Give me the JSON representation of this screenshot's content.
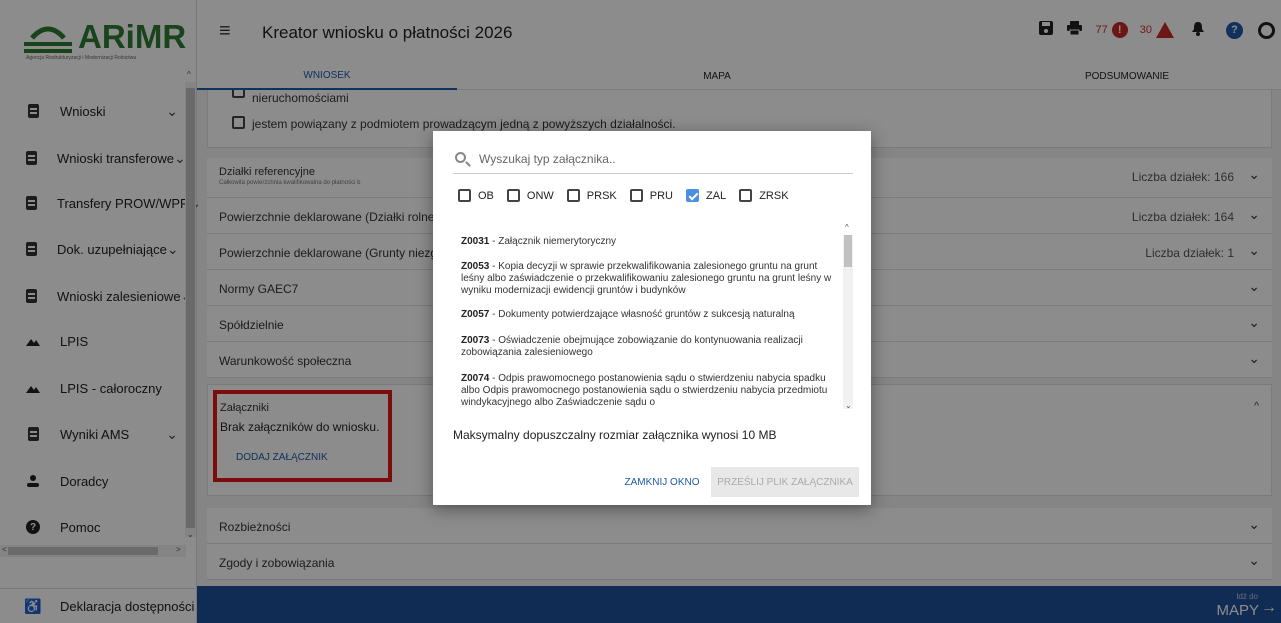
{
  "logo": {
    "name": "ARiMR",
    "subtitle": "Agencja Restrukturyzacji i Modernizacji Rolnictwa"
  },
  "sidebar": {
    "items": [
      {
        "label": "Wnioski",
        "icon": "document-icon",
        "expandable": true
      },
      {
        "label": "Wnioski transferowe",
        "icon": "document-icon",
        "expandable": true
      },
      {
        "label": "Transfery PROW/WPR",
        "icon": "document-icon",
        "expandable": true
      },
      {
        "label": "Dok. uzupełniające",
        "icon": "document-icon",
        "expandable": true
      },
      {
        "label": "Wnioski zalesieniowe",
        "icon": "document-icon",
        "expandable": true
      },
      {
        "label": "LPIS",
        "icon": "terrain-icon",
        "expandable": false
      },
      {
        "label": "LPIS - całoroczny",
        "icon": "terrain-icon",
        "expandable": false
      },
      {
        "label": "Wyniki AMS",
        "icon": "document-icon",
        "expandable": true
      },
      {
        "label": "Doradcy",
        "icon": "person-icon",
        "expandable": false
      },
      {
        "label": "Pomoc",
        "icon": "help-icon",
        "expandable": false
      }
    ],
    "accessibility": "Deklaracja dostępności"
  },
  "header": {
    "title": "Kreator wniosku o płatności 2026",
    "error_count": "77",
    "warning_count": "30",
    "error_badge": "!",
    "help_badge": "?"
  },
  "tabs": [
    {
      "label": "WNIOSEK",
      "active": true
    },
    {
      "label": "MAPA",
      "active": false
    },
    {
      "label": "PODSUMOWANIE",
      "active": false
    }
  ],
  "main": {
    "checkbox_partial_label": "nieruchomościami",
    "checkbox_label": "jestem powiązany z podmiotem prowadzącym jedną z powyższych działalności.",
    "sections": [
      {
        "label": "Działki referencyjne",
        "sub": "Całkowita powierzchnia kwalifikowalna do płatności b",
        "right": "Liczba działek: 166"
      },
      {
        "label": "Powierzchnie deklarowane (Działki rolne)",
        "right": "Liczba działek: 164"
      },
      {
        "label": "Powierzchnie deklarowane (Grunty niezgło",
        "right": "Liczba działek: 1"
      },
      {
        "label": "Normy GAEC7",
        "right": ""
      },
      {
        "label": "Spółdzielnie",
        "right": ""
      },
      {
        "label": "Warunkowość społeczna",
        "right": ""
      }
    ],
    "attachments": {
      "title": "Załączniki",
      "empty": "Brak załączników do wniosku.",
      "add_button": "DODAJ ZAŁĄCZNIK"
    },
    "sections_bottom": [
      {
        "label": "Rozbieżności"
      },
      {
        "label": "Zgody i zobowiązania"
      }
    ]
  },
  "footer": {
    "small": "Idź do",
    "big": "MAPY"
  },
  "modal": {
    "search_placeholder": "Wyszukaj typ załącznika..",
    "filters": [
      {
        "label": "OB",
        "checked": false
      },
      {
        "label": "ONW",
        "checked": false
      },
      {
        "label": "PRSK",
        "checked": false
      },
      {
        "label": "PRU",
        "checked": false
      },
      {
        "label": "ZAL",
        "checked": true
      },
      {
        "label": "ZRSK",
        "checked": false
      }
    ],
    "items": [
      {
        "code": "Z0031",
        "text": " - Załącznik niemerytoryczny"
      },
      {
        "code": "Z0053",
        "text": " - Kopia decyzji w sprawie przekwalifikowania zalesionego gruntu na grunt leśny albo zaświadczenie o przekwalifikowaniu zalesionego gruntu na grunt leśny w wyniku modernizacji ewidencji gruntów i budynków"
      },
      {
        "code": "Z0057",
        "text": " - Dokumenty potwierdzające własność gruntów z sukcesją naturalną"
      },
      {
        "code": "Z0073",
        "text": " - Oświadczenie obejmujące zobowiązanie do kontynuowania realizacji zobowiązania zalesieniowego"
      },
      {
        "code": "Z0074",
        "text": " - Odpis prawomocnego postanowienia sądu o stwierdzeniu nabycia spadku albo Odpis prawomocnego postanowienia sądu o stwierdzeniu nabycia przedmiotu windykacyjnego albo Zaświadczenie sądu o"
      }
    ],
    "max_size": "Maksymalny dopuszczalny rozmiar załącznika wynosi 10 MB",
    "close_button": "ZAMKNIJ OKNO",
    "send_button": "PRZEŚLIJ PLIK ZAŁĄCZNIKA"
  },
  "colors": {
    "brand_green": "#2e7d32",
    "primary_blue": "#1e5aa8",
    "footer_blue": "#1e4f9a",
    "error_red": "#c62828",
    "highlight_red": "#e01818"
  }
}
